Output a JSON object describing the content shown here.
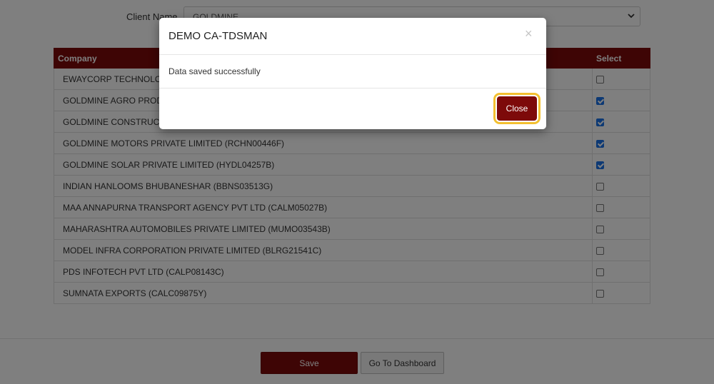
{
  "client": {
    "label": "Client Name",
    "selected": "GOLDMINE"
  },
  "table": {
    "headers": {
      "company": "Company",
      "select": "Select"
    },
    "rows": [
      {
        "name": "EWAYCORP TECHNOLOGIES",
        "checked": false
      },
      {
        "name": "GOLDMINE AGRO PRODUCTS",
        "checked": true
      },
      {
        "name": "GOLDMINE CONSTRUCTIONS",
        "checked": true
      },
      {
        "name": "GOLDMINE MOTORS PRIVATE LIMITED  (RCHN00446F)",
        "checked": true
      },
      {
        "name": "GOLDMINE SOLAR PRIVATE LIMITED  (HYDL04257B)",
        "checked": true
      },
      {
        "name": "INDIAN HANLOOMS BHUBANESHAR  (BBNS03513G)",
        "checked": false
      },
      {
        "name": "MAA ANNAPURNA TRANSPORT AGENCY PVT LTD  (CALM05027B)",
        "checked": false
      },
      {
        "name": "MAHARASHTRA AUTOMOBILES PRIVATE LIMITED  (MUMO03543B)",
        "checked": false
      },
      {
        "name": "MODEL INFRA CORPORATION PRIVATE LIMITED  (BLRG21541C)",
        "checked": false
      },
      {
        "name": "PDS INFOTECH PVT LTD  (CALP08143C)",
        "checked": false
      },
      {
        "name": "SUMNATA EXPORTS  (CALC09875Y)",
        "checked": false
      }
    ]
  },
  "footer": {
    "save_label": "Save",
    "dashboard_label": "Go To Dashboard"
  },
  "modal": {
    "title": "DEMO CA-TDSMAN",
    "close_x": "×",
    "message": "Data saved successfully",
    "close_label": "Close"
  },
  "colors": {
    "brand": "#7d0a0a",
    "checkbox_checked": "#1a73e8",
    "focus_ring": "#f3c030"
  }
}
